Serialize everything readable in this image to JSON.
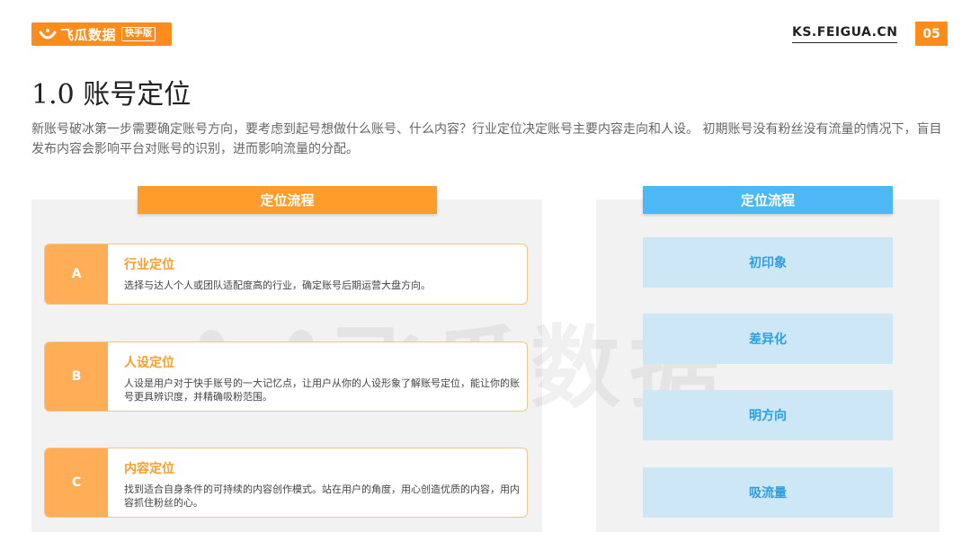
{
  "header": {
    "logo_name": "飞瓜数据",
    "logo_tag": "快手版",
    "site": "KS.FEIGUA.CN",
    "page_number": "05",
    "brand_color": "#ff8c1a"
  },
  "title": "1.0 账号定位",
  "intro": "新账号破冰第一步需要确定账号方向，要考虑到起号想做什么账号、什么内容？行业定位决定账号主要内容走向和人设。 初期账号没有粉丝没有流量的情况下，盲目发布内容会影响平台对账号的识别，进而影响流量的分配。",
  "watermark": "飞瓜数据",
  "left": {
    "header": "定位流程",
    "cards": [
      {
        "badge": "A",
        "title": "行业定位",
        "desc": "选择与达人个人或团队适配度高的行业，确定账号后期运营大盘方向。"
      },
      {
        "badge": "B",
        "title": "人设定位",
        "desc": "人设是用户对于快手账号的一大记忆点，让用户从你的人设形象了解账号定位，能让你的账号更具辨识度，并精确吸粉范围。"
      },
      {
        "badge": "C",
        "title": "内容定位",
        "desc": "找到适合自身条件的可持续的内容创作模式。站在用户的角度，用心创造优质的内容，用内容抓住粉丝的心。"
      }
    ]
  },
  "right": {
    "header": "定位流程",
    "steps": [
      "初印象",
      "差异化",
      "明方向",
      "吸流量"
    ]
  }
}
